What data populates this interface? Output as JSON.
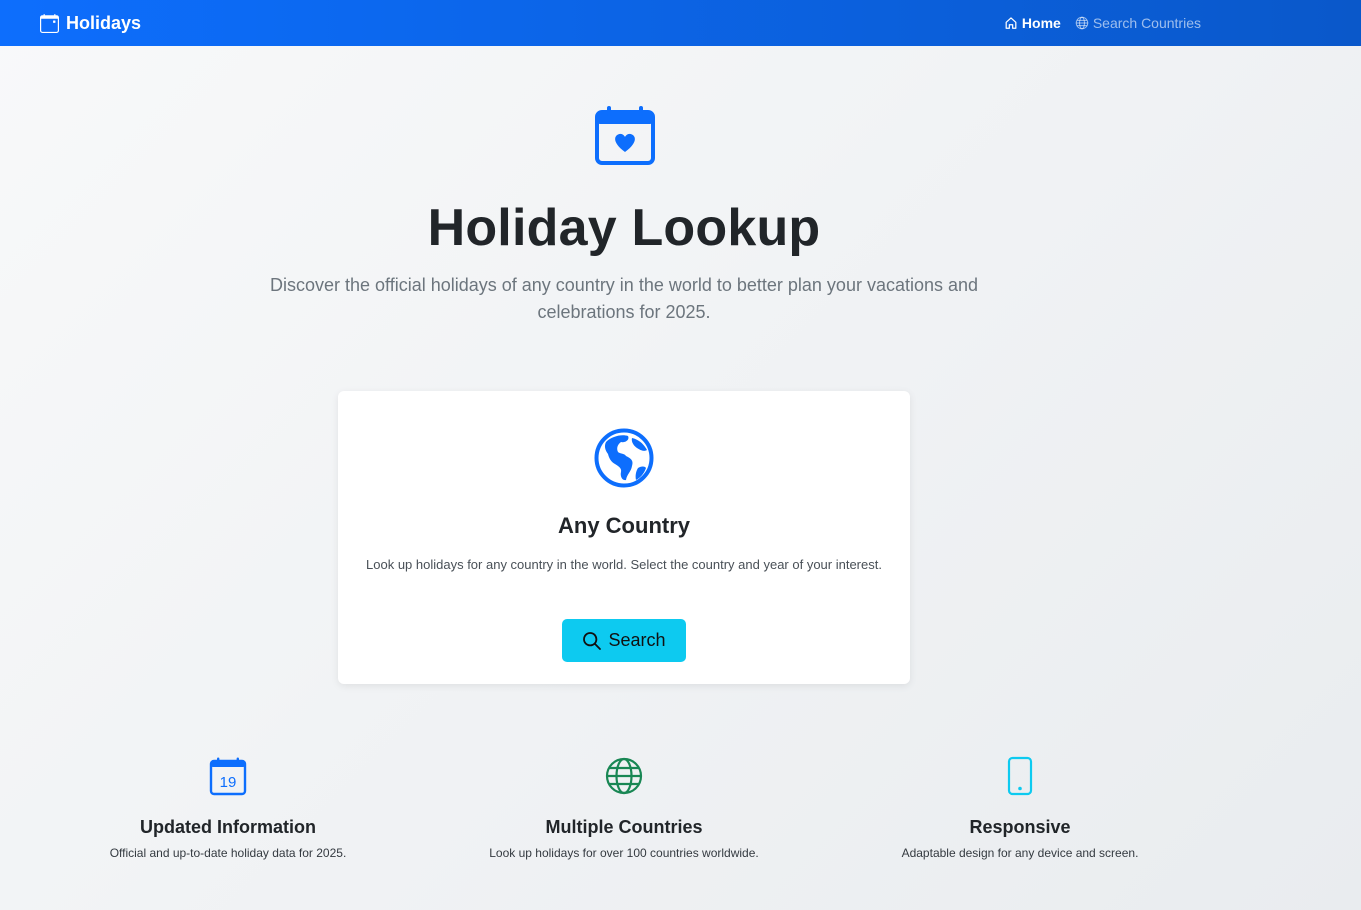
{
  "navbar": {
    "brand": "Holidays",
    "links": [
      {
        "label": "Home",
        "icon": "house-icon",
        "active": true
      },
      {
        "label": "Search Countries",
        "icon": "globe-icon",
        "active": false
      }
    ]
  },
  "hero": {
    "icon": "calendar-heart-icon",
    "title": "Holiday Lookup",
    "subtitle": "Discover the official holidays of any country in the world to better plan your vacations and celebrations for 2025."
  },
  "card": {
    "icon": "globe-americas-icon",
    "title": "Any Country",
    "text": "Look up holidays for any country in the world. Select the country and year of your interest.",
    "button_label": "Search",
    "button_icon": "search-icon"
  },
  "features": [
    {
      "icon": "calendar-date-icon",
      "icon_text": "19",
      "title": "Updated Information",
      "text": "Official and up-to-date holiday data for 2025."
    },
    {
      "icon": "globe-icon",
      "title": "Multiple Countries",
      "text": "Look up holidays for over 100 countries worldwide."
    },
    {
      "icon": "phone-icon",
      "title": "Responsive",
      "text": "Adaptable design for any device and screen."
    }
  ],
  "colors": {
    "primary": "#0d6efd",
    "info": "#0dcaf0",
    "success": "#198754",
    "text_dark": "#212529",
    "text_muted": "#6c757d"
  }
}
